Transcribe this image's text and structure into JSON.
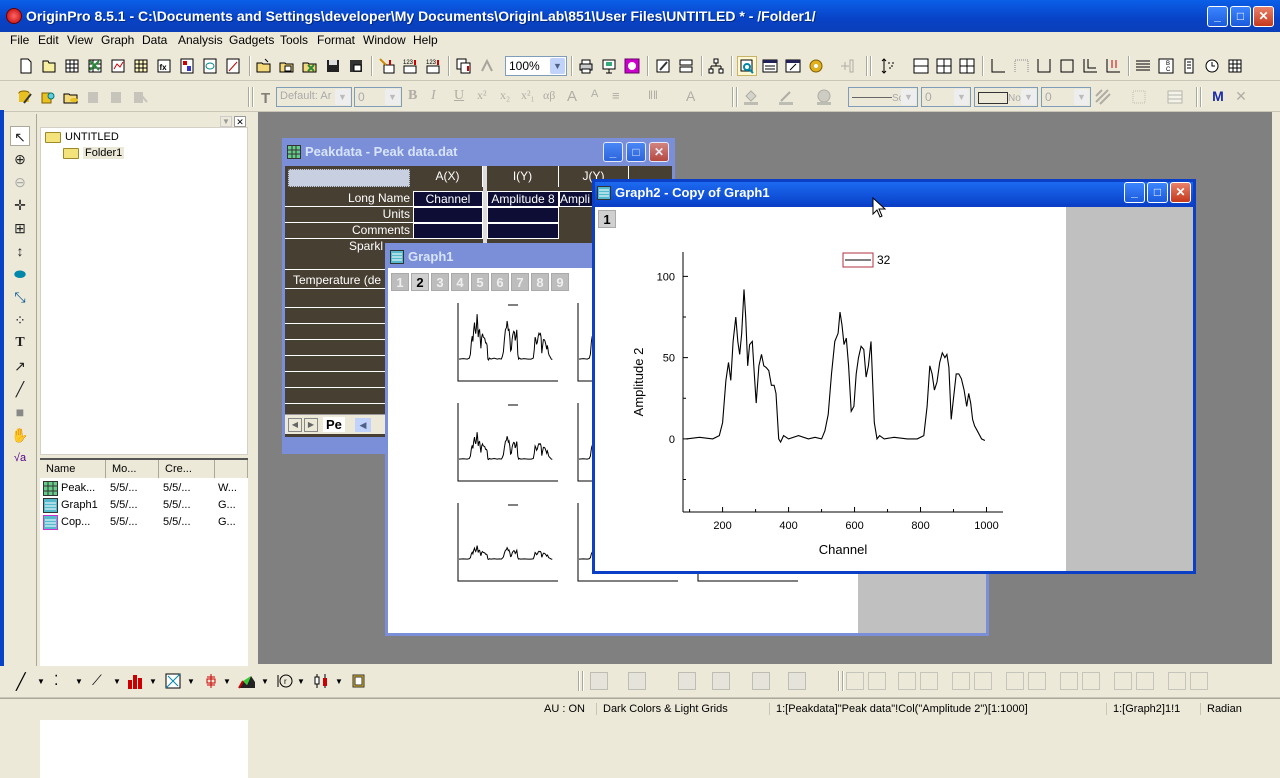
{
  "app": {
    "title": "OriginPro 8.5.1 - C:\\Documents and Settings\\developer\\My Documents\\OriginLab\\851\\User Files\\UNTITLED * - /Folder1/"
  },
  "menu": [
    "File",
    "Edit",
    "View",
    "Graph",
    "Data",
    "Analysis",
    "Gadgets",
    "Tools",
    "Format",
    "Window",
    "Help"
  ],
  "toolbar": {
    "zoom_value": "100%",
    "font_name": "Default: Ar",
    "font_size": "0",
    "line_width": "0",
    "pattern_size": "0",
    "line_style_label": "So",
    "fill_label": "No"
  },
  "project_explorer": {
    "root": "UNTITLED",
    "folder": "Folder1",
    "columns": [
      "Name",
      "Mo...",
      "Cre..."
    ],
    "items": [
      {
        "name": "Peak...",
        "modified": "5/5/...",
        "created": "5/5/...",
        "type": "W..."
      },
      {
        "name": "Graph1",
        "modified": "5/5/...",
        "created": "5/5/...",
        "type": "G..."
      },
      {
        "name": "Cop...",
        "modified": "5/5/...",
        "created": "5/5/...",
        "type": "G..."
      }
    ]
  },
  "worksheet": {
    "title": "Peakdata - Peak data.dat",
    "columns": [
      "A(X)",
      "I(Y)",
      "J(Y)"
    ],
    "row_labels": [
      "Long Name",
      "Units",
      "Comments",
      "Sparkl",
      "Temperature (de"
    ],
    "long_names": [
      "Channel",
      "Amplitude 8",
      "Ampli"
    ],
    "sheet_tab": "Pe"
  },
  "graph1": {
    "title": "Graph1",
    "layers": [
      "1",
      "2",
      "3",
      "4",
      "5",
      "6",
      "7",
      "8",
      "9"
    ],
    "active_layer": "2"
  },
  "graph2": {
    "title": "Graph2 - Copy of Graph1",
    "layer": "1"
  },
  "chart_data": {
    "type": "line",
    "title": "",
    "xlabel": "Channel",
    "ylabel": "Amplitude 2",
    "xlim": [
      80,
      1050
    ],
    "ylim": [
      -45,
      115
    ],
    "xticks": [
      200,
      400,
      600,
      800,
      1000
    ],
    "yticks": [
      0,
      50,
      100
    ],
    "legend": {
      "entries": [
        "32"
      ],
      "position": "top-center"
    },
    "grid": false,
    "series": [
      {
        "name": "32",
        "x": [
          90,
          130,
          170,
          190,
          200,
          210,
          218,
          225,
          232,
          240,
          246,
          252,
          258,
          265,
          270,
          276,
          282,
          290,
          296,
          302,
          310,
          318,
          325,
          332,
          340,
          348,
          356,
          362,
          370,
          376,
          385,
          400,
          430,
          460,
          480,
          500,
          510,
          520,
          530,
          540,
          550,
          556,
          562,
          568,
          575,
          582,
          590,
          598,
          605,
          612,
          620,
          628,
          635,
          642,
          650,
          660,
          668,
          676,
          690,
          720,
          760,
          790,
          810,
          820,
          828,
          835,
          842,
          850,
          858,
          866,
          874,
          880,
          886,
          893,
          900,
          908,
          916,
          924,
          932,
          940,
          946,
          952,
          958,
          964,
          972,
          985,
          995
        ],
        "y": [
          0,
          1,
          0,
          2,
          10,
          36,
          47,
          36,
          60,
          75,
          60,
          52,
          65,
          92,
          75,
          45,
          58,
          60,
          40,
          22,
          45,
          52,
          45,
          44,
          42,
          33,
          33,
          28,
          0,
          -2,
          2,
          0,
          2,
          0,
          1,
          0,
          5,
          15,
          40,
          60,
          65,
          78,
          70,
          58,
          62,
          45,
          17,
          20,
          40,
          50,
          57,
          55,
          38,
          45,
          60,
          10,
          0,
          2,
          0,
          1,
          0,
          0,
          2,
          20,
          45,
          40,
          30,
          35,
          47,
          53,
          50,
          52,
          44,
          12,
          25,
          40,
          40,
          37,
          30,
          20,
          28,
          22,
          12,
          8,
          5,
          0,
          -1
        ]
      }
    ]
  },
  "status": {
    "au": "AU : ON",
    "theme": "Dark Colors & Light Grids",
    "selection": "1:[Peakdata]\"Peak data\"!Col(\"Amplitude 2\")[1:1000]",
    "active": "1:[Graph2]1!1",
    "angle": "Radian"
  }
}
